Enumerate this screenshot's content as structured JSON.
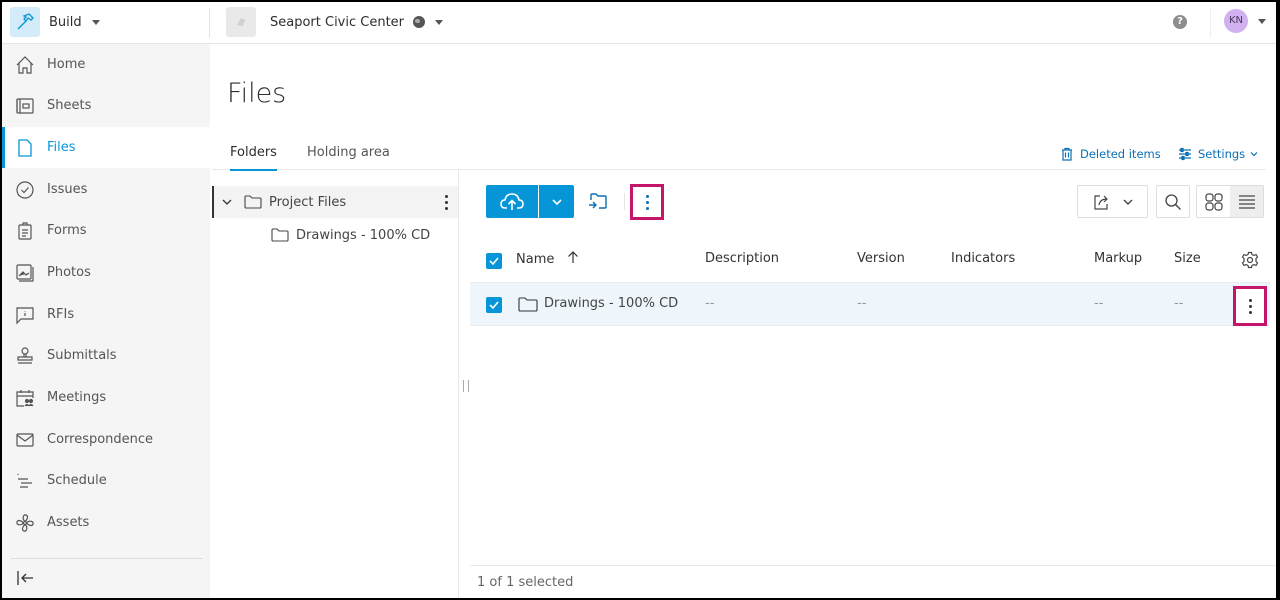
{
  "topbar": {
    "app_name": "Build",
    "project_name": "Seaport Civic Center",
    "help_symbol": "?",
    "user_initials": "KN",
    "icons": {
      "app": "hammer-icon",
      "project": "project-thumbnail-icon",
      "globe": "globe-icon",
      "help": "help-icon"
    }
  },
  "sidebar": {
    "items": [
      {
        "label": "Home",
        "icon": "home-icon",
        "active": false
      },
      {
        "label": "Sheets",
        "icon": "sheets-icon",
        "active": false
      },
      {
        "label": "Files",
        "icon": "file-icon",
        "active": true
      },
      {
        "label": "Issues",
        "icon": "check-circle-icon",
        "active": false
      },
      {
        "label": "Forms",
        "icon": "clipboard-icon",
        "active": false
      },
      {
        "label": "Photos",
        "icon": "photos-icon",
        "active": false
      },
      {
        "label": "RFIs",
        "icon": "rfi-chat-icon",
        "active": false
      },
      {
        "label": "Submittals",
        "icon": "stamp-icon",
        "active": false
      },
      {
        "label": "Meetings",
        "icon": "meetings-calendar-icon",
        "active": false
      },
      {
        "label": "Correspondence",
        "icon": "envelope-icon",
        "active": false
      },
      {
        "label": "Schedule",
        "icon": "schedule-icon",
        "active": false
      },
      {
        "label": "Assets",
        "icon": "fan-icon",
        "active": false
      }
    ],
    "collapse_icon": "collapse-left-icon"
  },
  "main": {
    "title": "Files",
    "tabs": [
      {
        "label": "Folders",
        "active": true
      },
      {
        "label": "Holding area",
        "active": false
      }
    ],
    "deleted_items_label": "Deleted items",
    "settings_label": "Settings"
  },
  "tree": {
    "items": [
      {
        "label": "Project Files",
        "level": 0,
        "expanded": true,
        "selected": true
      },
      {
        "label": "Drawings - 100% CD",
        "level": 1,
        "expanded": false,
        "selected": false
      }
    ]
  },
  "table": {
    "columns": [
      "Name",
      "Description",
      "Version",
      "Indicators",
      "Markup",
      "Size"
    ],
    "sort": {
      "column": "Name",
      "direction": "ascending"
    },
    "header_checked": true,
    "rows": [
      {
        "checked": true,
        "name": "Drawings - 100% CD",
        "type": "folder",
        "description": "--",
        "version": "--",
        "indicators": "",
        "markup": "--",
        "size": "--"
      }
    ]
  },
  "footer": {
    "selection_text": "1 of 1 selected"
  },
  "colors": {
    "accent": "#0696d7",
    "highlight_box": "#c4156a",
    "row_selected": "#eef6fc",
    "sidebar_bg": "#f5f5f5"
  }
}
